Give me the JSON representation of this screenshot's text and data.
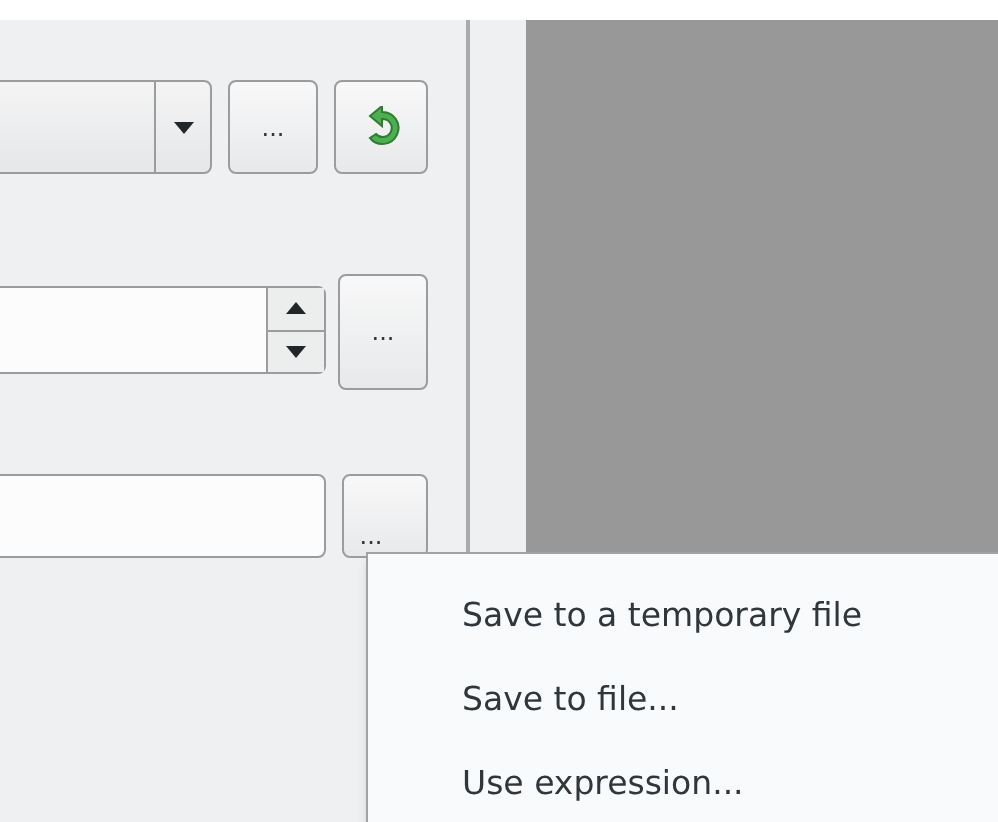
{
  "combo_row": {
    "more_button": "..."
  },
  "spin_row": {
    "more_button": "..."
  },
  "file_row": {
    "more_button": "..."
  },
  "menu": {
    "items": [
      {
        "label": "Save to a temporary file"
      },
      {
        "label": "Save to file..."
      },
      {
        "label": "Use expression..."
      }
    ]
  }
}
